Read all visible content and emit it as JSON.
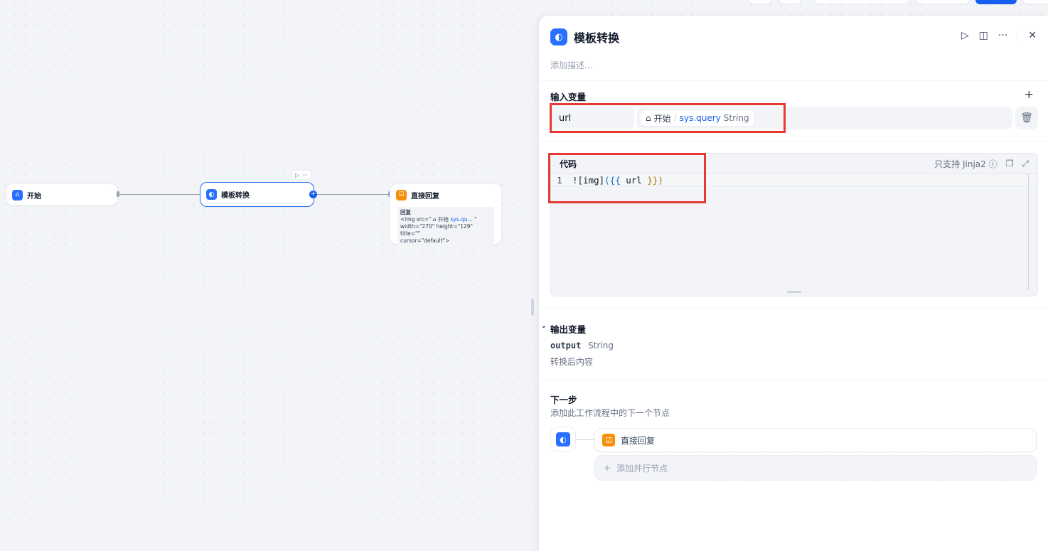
{
  "canvas": {
    "nodes": {
      "start": {
        "title": "开始"
      },
      "template": {
        "title": "模板转换"
      },
      "answer": {
        "title": "直接回复",
        "content_label": "回复",
        "line1_prefix": "<img src=\"",
        "line1_node": "开始",
        "line1_var": "sys.qu...",
        "line1_suffix": "\"",
        "line2": "width=\"270\" height=\"129\" title=\"\"",
        "line3": "cursor=\"default\">"
      }
    }
  },
  "panel": {
    "title": "模板转换",
    "description_placeholder": "添加描述...",
    "input_section": {
      "title": "输入变量",
      "variables": [
        {
          "name": "url",
          "source_node": "开始",
          "source_var": "sys.query",
          "type": "String"
        }
      ]
    },
    "code_section": {
      "title": "代码",
      "hint": "只支持 Jinja2",
      "lines": [
        {
          "number": "1",
          "prefix": "![img]",
          "open": "({{",
          "var": " url ",
          "close": "}})"
        }
      ]
    },
    "output_section": {
      "title": "输出变量",
      "variables": [
        {
          "name": "output",
          "type": "String",
          "description": "转换后内容"
        }
      ]
    },
    "next_section": {
      "title": "下一步",
      "subtitle": "添加此工作流程中的下一个节点",
      "next_node": "直接回复",
      "add_parallel": "添加并行节点"
    }
  },
  "colors": {
    "accent": "#155eef",
    "template_icon": "#2970ff",
    "answer_icon": "#f79009",
    "annotation_box": "#e53935"
  }
}
